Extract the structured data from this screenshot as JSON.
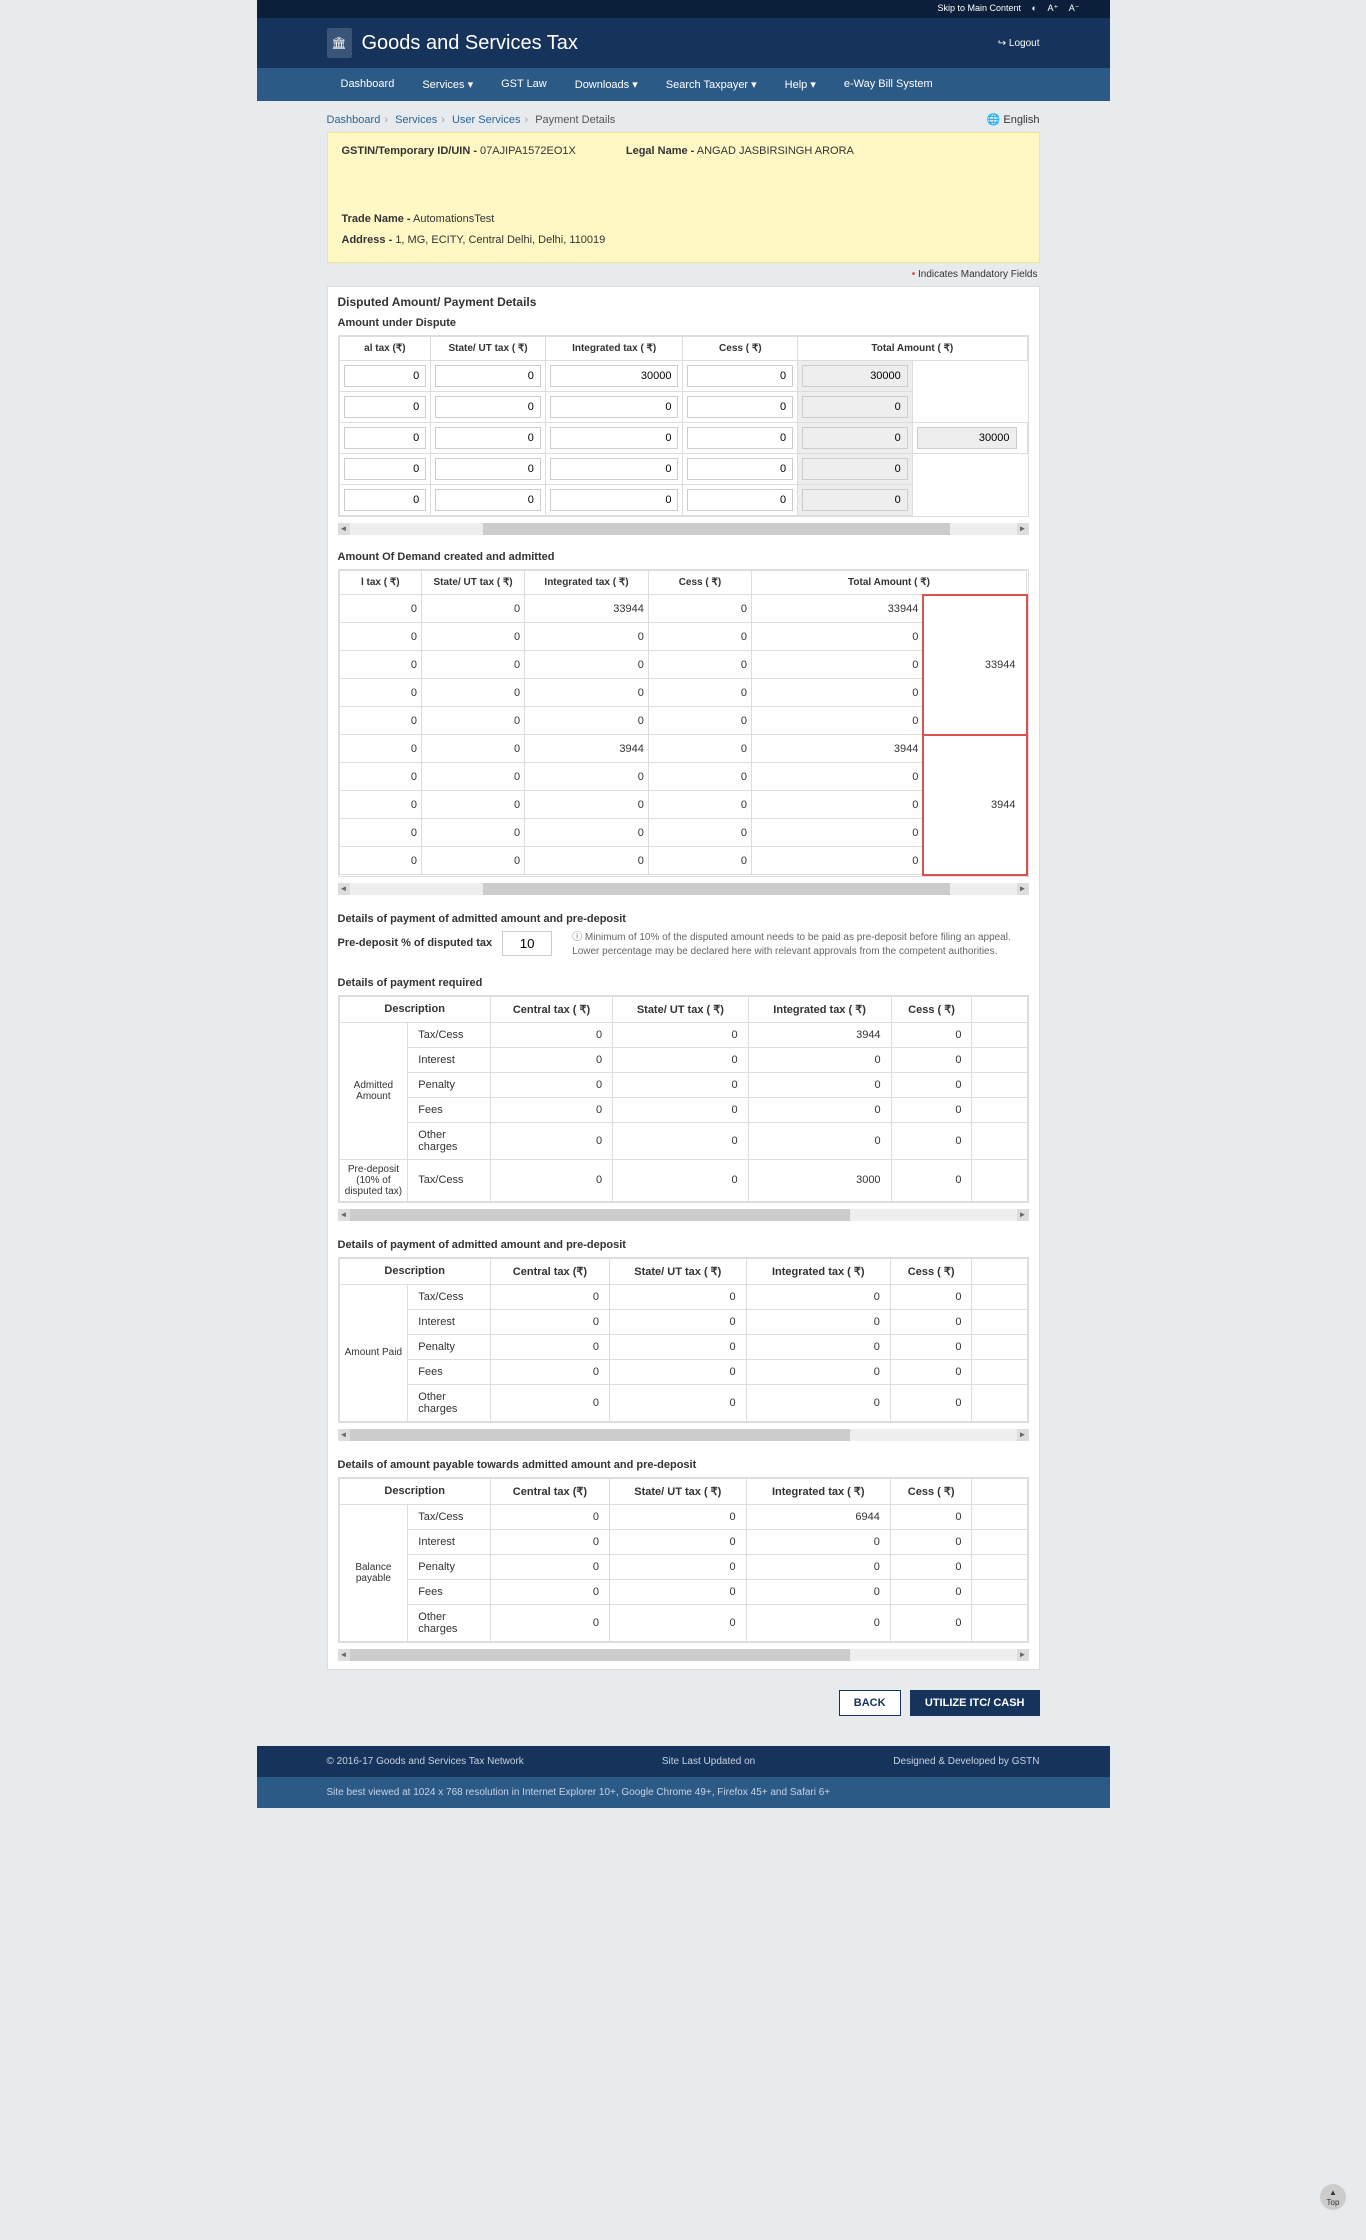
{
  "topbar": {
    "skip": "Skip to Main Content",
    "contrast": "◐",
    "a_plus": "A⁺",
    "a_minus": "A⁻"
  },
  "header": {
    "title": "Goods and Services Tax",
    "logout": "Logout"
  },
  "nav": {
    "dashboard": "Dashboard",
    "services": "Services ▾",
    "gstlaw": "GST Law",
    "downloads": "Downloads ▾",
    "search": "Search Taxpayer ▾",
    "help": "Help ▾",
    "eway": "e-Way Bill System"
  },
  "crumbs": {
    "c1": "Dashboard",
    "c2": "Services",
    "c3": "User Services",
    "c4": "Payment Details",
    "lang": "🌐 English"
  },
  "info": {
    "gstin_l": "GSTIN/Temporary ID/UIN -",
    "gstin_v": "07AJIPA1572EO1X",
    "legal_l": "Legal Name -",
    "legal_v": "ANGAD JASBIRSINGH ARORA",
    "trade_l": "Trade Name -",
    "trade_v": "AutomationsTest",
    "addr_l": "Address -",
    "addr_v": "1, MG, ECITY, Central Delhi, Delhi, 110019"
  },
  "mandatory": "Indicates Mandatory Fields",
  "sec1": {
    "title": "Disputed Amount/ Payment Details",
    "sub": "Amount under Dispute"
  },
  "cols": {
    "tax": "al tax (₹)",
    "sut": "State/ UT tax ( ₹)",
    "igst": "Integrated tax ( ₹)",
    "cess": "Cess ( ₹)",
    "total": "Total Amount ( ₹)"
  },
  "cols2": {
    "tax": "l tax ( ₹)",
    "sut": "State/ UT tax ( ₹)",
    "igst": "Integrated tax ( ₹)",
    "cess": "Cess ( ₹)",
    "total": "Total Amount ( ₹)"
  },
  "dispute_rows": [
    {
      "t": "0",
      "s": "0",
      "i": "30000",
      "c": "0",
      "sub": "30000"
    },
    {
      "t": "0",
      "s": "0",
      "i": "0",
      "c": "0",
      "sub": "0"
    },
    {
      "t": "0",
      "s": "0",
      "i": "0",
      "c": "0",
      "sub": "0"
    },
    {
      "t": "0",
      "s": "0",
      "i": "0",
      "c": "0",
      "sub": "0"
    },
    {
      "t": "0",
      "s": "0",
      "i": "0",
      "c": "0",
      "sub": "0"
    }
  ],
  "dispute_total": "30000",
  "sec2": "Amount Of Demand created and admitted",
  "demand_top": [
    {
      "t": "0",
      "s": "0",
      "i": "33944",
      "c": "0",
      "sub": "33944"
    },
    {
      "t": "0",
      "s": "0",
      "i": "0",
      "c": "0",
      "sub": "0"
    },
    {
      "t": "0",
      "s": "0",
      "i": "0",
      "c": "0",
      "sub": "0"
    },
    {
      "t": "0",
      "s": "0",
      "i": "0",
      "c": "0",
      "sub": "0"
    },
    {
      "t": "0",
      "s": "0",
      "i": "0",
      "c": "0",
      "sub": "0"
    }
  ],
  "demand_total1": "33944",
  "demand_bot": [
    {
      "t": "0",
      "s": "0",
      "i": "3944",
      "c": "0",
      "sub": "3944"
    },
    {
      "t": "0",
      "s": "0",
      "i": "0",
      "c": "0",
      "sub": "0"
    },
    {
      "t": "0",
      "s": "0",
      "i": "0",
      "c": "0",
      "sub": "0"
    },
    {
      "t": "0",
      "s": "0",
      "i": "0",
      "c": "0",
      "sub": "0"
    },
    {
      "t": "0",
      "s": "0",
      "i": "0",
      "c": "0",
      "sub": "0"
    }
  ],
  "demand_total2": "3944",
  "sec3": "Details of payment of admitted amount and pre-deposit",
  "pd_label": "Pre-deposit % of disputed tax",
  "pd_val": "10",
  "pd_note": "Minimum of 10% of the disputed amount needs to be paid as pre-deposit before filing an appeal. Lower percentage may be declared here with relevant approvals from the competent authorities.",
  "sec4": "Details of payment required",
  "gcols": {
    "desc": "Description",
    "ct": "Central tax ( ₹)",
    "st": "State/ UT tax ( ₹)",
    "it": "Integrated tax ( ₹)",
    "cs": "Cess ( ₹)"
  },
  "gcols2": {
    "desc": "Description",
    "ct": "Central tax (₹)",
    "st": "State/ UT tax ( ₹)",
    "it": "Integrated tax ( ₹)",
    "cs": "Cess ( ₹)"
  },
  "rowlabels": {
    "tc": "Tax/Cess",
    "int": "Interest",
    "pen": "Penalty",
    "fee": "Fees",
    "oth": "Other charges"
  },
  "grp_admitted": "Admitted Amount",
  "grp_predep": "Pre-deposit (10% of disputed tax)",
  "req_rows": {
    "admitted": [
      {
        "l": "tc",
        "ct": "0",
        "st": "0",
        "it": "3944",
        "cs": "0"
      },
      {
        "l": "int",
        "ct": "0",
        "st": "0",
        "it": "0",
        "cs": "0"
      },
      {
        "l": "pen",
        "ct": "0",
        "st": "0",
        "it": "0",
        "cs": "0"
      },
      {
        "l": "fee",
        "ct": "0",
        "st": "0",
        "it": "0",
        "cs": "0"
      },
      {
        "l": "oth",
        "ct": "0",
        "st": "0",
        "it": "0",
        "cs": "0"
      }
    ],
    "predep": {
      "l": "tc",
      "ct": "0",
      "st": "0",
      "it": "3000",
      "cs": "0"
    }
  },
  "sec5": "Details of payment of admitted amount and pre-deposit",
  "grp_paid": "Amount Paid",
  "paid_rows": [
    {
      "l": "tc",
      "ct": "0",
      "st": "0",
      "it": "0",
      "cs": "0"
    },
    {
      "l": "int",
      "ct": "0",
      "st": "0",
      "it": "0",
      "cs": "0"
    },
    {
      "l": "pen",
      "ct": "0",
      "st": "0",
      "it": "0",
      "cs": "0"
    },
    {
      "l": "fee",
      "ct": "0",
      "st": "0",
      "it": "0",
      "cs": "0"
    },
    {
      "l": "oth",
      "ct": "0",
      "st": "0",
      "it": "0",
      "cs": "0"
    }
  ],
  "sec6": "Details of amount payable towards admitted amount and pre-deposit",
  "grp_bal": "Balance payable",
  "bal_rows": [
    {
      "l": "tc",
      "ct": "0",
      "st": "0",
      "it": "6944",
      "cs": "0"
    },
    {
      "l": "int",
      "ct": "0",
      "st": "0",
      "it": "0",
      "cs": "0"
    },
    {
      "l": "pen",
      "ct": "0",
      "st": "0",
      "it": "0",
      "cs": "0"
    },
    {
      "l": "fee",
      "ct": "0",
      "st": "0",
      "it": "0",
      "cs": "0"
    },
    {
      "l": "oth",
      "ct": "0",
      "st": "0",
      "it": "0",
      "cs": "0"
    }
  ],
  "btn_back": "BACK",
  "btn_util": "UTILIZE ITC/ CASH",
  "footer": {
    "copy": "© 2016-17 Goods and Services Tax Network",
    "site": "Site Last Updated on",
    "dev": "Designed & Developed by GSTN",
    "bestview": "Site best viewed at 1024 x 768 resolution in Internet Explorer 10+, Google Chrome 49+, Firefox 45+ and Safari 6+"
  },
  "top": "Top"
}
